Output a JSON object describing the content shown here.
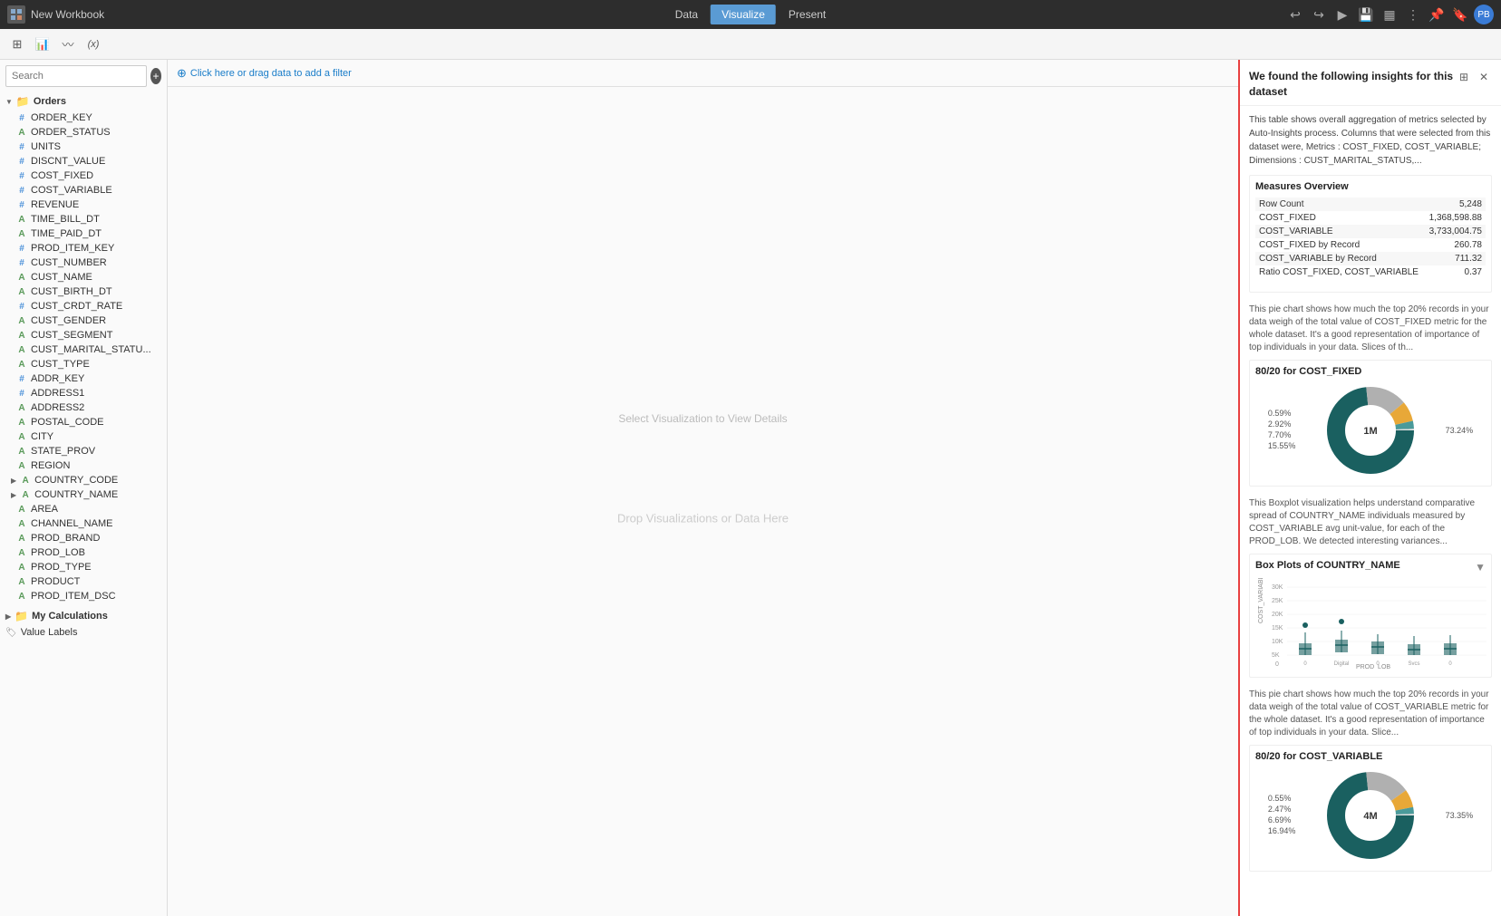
{
  "app": {
    "title": "New Workbook",
    "nav_tabs": [
      "Data",
      "Visualize",
      "Present"
    ]
  },
  "toolbar": {
    "icons": [
      "table-icon",
      "chart-icon",
      "line-icon",
      "x-icon"
    ]
  },
  "search": {
    "placeholder": "Search",
    "value": ""
  },
  "tree": {
    "orders_group": "Orders",
    "fields": [
      {
        "name": "ORDER_KEY",
        "type": "hash"
      },
      {
        "name": "ORDER_STATUS",
        "type": "a"
      },
      {
        "name": "UNITS",
        "type": "hash"
      },
      {
        "name": "DISCNT_VALUE",
        "type": "hash"
      },
      {
        "name": "COST_FIXED",
        "type": "hash"
      },
      {
        "name": "COST_VARIABLE",
        "type": "hash"
      },
      {
        "name": "REVENUE",
        "type": "hash"
      },
      {
        "name": "TIME_BILL_DT",
        "type": "a"
      },
      {
        "name": "TIME_PAID_DT",
        "type": "a"
      },
      {
        "name": "PROD_ITEM_KEY",
        "type": "hash"
      },
      {
        "name": "CUST_NUMBER",
        "type": "hash"
      },
      {
        "name": "CUST_NAME",
        "type": "a"
      },
      {
        "name": "CUST_BIRTH_DT",
        "type": "a"
      },
      {
        "name": "CUST_CRDT_RATE",
        "type": "hash"
      },
      {
        "name": "CUST_GENDER",
        "type": "a"
      },
      {
        "name": "CUST_SEGMENT",
        "type": "a"
      },
      {
        "name": "CUST_MARITAL_STATU...",
        "type": "a"
      },
      {
        "name": "CUST_TYPE",
        "type": "a"
      },
      {
        "name": "ADDR_KEY",
        "type": "hash"
      },
      {
        "name": "ADDRESS1",
        "type": "hash"
      },
      {
        "name": "ADDRESS2",
        "type": "a"
      },
      {
        "name": "POSTAL_CODE",
        "type": "a"
      },
      {
        "name": "CITY",
        "type": "a"
      },
      {
        "name": "STATE_PROV",
        "type": "a"
      },
      {
        "name": "REGION",
        "type": "a"
      }
    ],
    "expandable_groups": [
      {
        "name": "COUNTRY_CODE",
        "type": "a"
      },
      {
        "name": "COUNTRY_NAME",
        "type": "a"
      }
    ],
    "more_fields": [
      {
        "name": "AREA",
        "type": "a"
      },
      {
        "name": "CHANNEL_NAME",
        "type": "a"
      },
      {
        "name": "PROD_BRAND",
        "type": "a"
      },
      {
        "name": "PROD_LOB",
        "type": "a"
      },
      {
        "name": "PROD_TYPE",
        "type": "a"
      },
      {
        "name": "PRODUCT",
        "type": "a"
      },
      {
        "name": "PROD_ITEM_DSC",
        "type": "a"
      }
    ],
    "my_calculations": "My Calculations",
    "value_labels": "Value Labels"
  },
  "canvas": {
    "filter_text": "Click here or drag data to add a filter",
    "hint_select": "Select Visualization to View Details",
    "hint_drop": "Drop Visualizations or Data Here"
  },
  "insights": {
    "header_title": "We found the following insights for this dataset",
    "description": "This table shows overall aggregation of metrics selected by Auto-Insights process. Columns that were selected from this dataset were, Metrics : COST_FIXED, COST_VARIABLE; Dimensions : CUST_MARITAL_STATUS,...",
    "measures_section": "Measures Overview",
    "measures": [
      {
        "label": "Row Count",
        "value": "5,248"
      },
      {
        "label": "COST_FIXED",
        "value": "1,368,598.88"
      },
      {
        "label": "COST_VARIABLE",
        "value": "3,733,004.75"
      },
      {
        "label": "COST_FIXED by Record",
        "value": "260.78"
      },
      {
        "label": "COST_VARIABLE by Record",
        "value": "711.32"
      },
      {
        "label": "Ratio COST_FIXED, COST_VARIABLE",
        "value": "0.37"
      }
    ],
    "chart1": {
      "description": "This pie chart shows how much the top 20% records in your data weigh of the total value of COST_FIXED metric for the whole dataset. It's a good representation of importance of top individuals in your data. Slices of th...",
      "title": "80/20 for COST_FIXED",
      "segments": [
        {
          "label": "0.59%",
          "color": "#e8e8e8",
          "value": 0.59
        },
        {
          "label": "2.92%",
          "color": "#4a9a9a",
          "value": 2.92
        },
        {
          "label": "7.70%",
          "color": "#e8a838",
          "value": 7.7
        },
        {
          "label": "15.55%",
          "color": "#b0b0b0",
          "value": 15.55
        },
        {
          "label": "73.24%",
          "color": "#1a6060",
          "value": 73.24
        }
      ],
      "center_label": "1M"
    },
    "chart2": {
      "description": "This Boxplot visualization helps understand comparative spread of COUNTRY_NAME individuals measured by COST_VARIABLE avg unit-value, for each of the PROD_LOB. We detected interesting variances...",
      "title": "Box Plots of COUNTRY_NAME",
      "x_label": "PROD_LOB",
      "y_label": "COST_VARIABLE by"
    },
    "chart3": {
      "description": "This pie chart shows how much the top 20% records in your data weigh of the total value of COST_VARIABLE metric for the whole dataset. It's a good representation of importance of top individuals in your data. Slice...",
      "title": "80/20 for COST_VARIABLE",
      "segments": [
        {
          "label": "0.55%",
          "color": "#e8e8e8",
          "value": 0.55
        },
        {
          "label": "2.47%",
          "color": "#4a9a9a",
          "value": 2.47
        },
        {
          "label": "6.69%",
          "color": "#e8a838",
          "value": 6.69
        },
        {
          "label": "16.94%",
          "color": "#b0b0b0",
          "value": 16.94
        },
        {
          "label": "73.35%",
          "color": "#1a6060",
          "value": 73.35
        }
      ],
      "center_label": "4M"
    }
  }
}
